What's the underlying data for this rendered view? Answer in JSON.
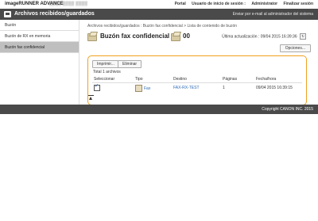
{
  "topbar": {
    "brand": "imageRUNNER ADVANCE",
    "device": "▒▒▒▒ ▒▒▒▒ ▒▒▒▒",
    "links": {
      "portal": "Portal",
      "login_user": "Usuario de inicio de sesión :",
      "user_name": "Administrator",
      "logout": "Finalizar sesión"
    }
  },
  "titlebar": {
    "title": "Archivos recibidos/guardados",
    "email_admin": "Enviar por e-mail al administrador del sistema"
  },
  "sidebar": {
    "items": [
      {
        "label": "Buzón"
      },
      {
        "label": "Buzón de RX en memoria"
      },
      {
        "label": "Buzón fax confidencial"
      }
    ]
  },
  "main": {
    "breadcrumb": "Archivos recibidos/guardados : Buzón fax confidencial > Lista de contenido de buzón",
    "title": "Buzón fax confidencial",
    "box_number": "00",
    "last_update": "Última actualización : 09/04 2015 16:39:36",
    "options_label": "Opciones...",
    "print_label": "Imprimir...",
    "delete_label": "Eliminar",
    "total": "Total 1 archivos",
    "table": {
      "headers": [
        "Seleccionar",
        "Tipo",
        "Destino",
        "Páginas",
        "Fecha/hora"
      ],
      "rows": [
        {
          "selected": true,
          "type": "Fax",
          "destination": "FAX-RX-TEST",
          "pages": "1",
          "datetime": "09/04 2015 16:39:15"
        }
      ]
    }
  },
  "footer": {
    "copyright": "Copyright CANON INC. 2015"
  },
  "colors": {
    "header_bg": "#4a4a4a",
    "panel_highlight": "#f0a020",
    "link": "#2a6ab5"
  }
}
